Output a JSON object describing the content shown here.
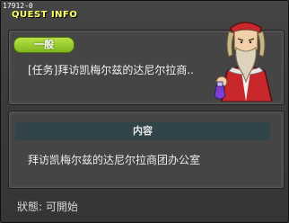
{
  "window": {
    "quest_id": "17912-0",
    "title": "QUEST INFO"
  },
  "quest": {
    "category_badge": "一般",
    "name": "[任务]拜访凯梅尔兹的达尼尔拉商..",
    "npc_portrait": "bearded-alchemist-npc"
  },
  "content": {
    "header": "内容",
    "description": "拜访凯梅尔兹的达尼尔拉商团办公室"
  },
  "status": {
    "text": "狀態:  可開始"
  },
  "colors": {
    "title": "#ffff66",
    "badge": "#8fc42a",
    "section_header": "#30444a",
    "background": "#3b3b3b"
  }
}
